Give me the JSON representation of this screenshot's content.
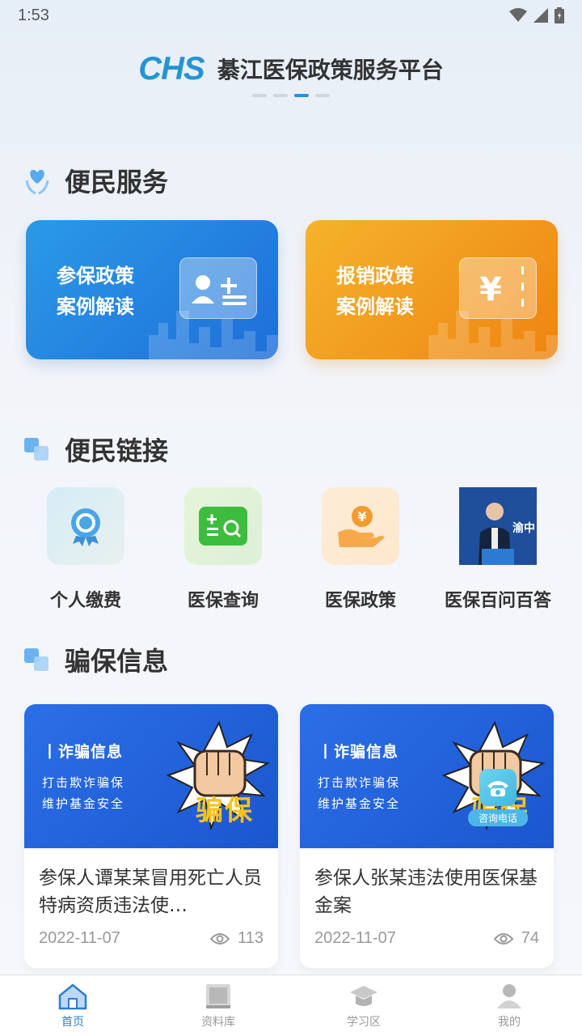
{
  "status": {
    "time": "1:53"
  },
  "banner": {
    "logo": "CHS",
    "title": "綦江医保政策服务平台"
  },
  "sections": {
    "services": "便民服务",
    "links": "便民链接",
    "fraud": "骗保信息"
  },
  "service_cards": [
    {
      "line1": "参保政策",
      "line2": "案例解读",
      "color": "#2a9ae8"
    },
    {
      "line1": "报销政策",
      "line2": "案例解读",
      "color": "#f5b32b"
    }
  ],
  "links": [
    {
      "label": "个人缴费",
      "icon": "badge-icon"
    },
    {
      "label": "医保查询",
      "icon": "search-card-icon"
    },
    {
      "label": "医保政策",
      "icon": "hand-yuan-icon"
    },
    {
      "label": "医保百问百答",
      "icon": "video-thumbnail"
    }
  ],
  "link_thumb_text": "渝中",
  "fraud_cards": [
    {
      "head": "丨诈骗信息",
      "sub1": "打击欺诈骗保",
      "sub2": "维护基金安全",
      "stamp": "骗保",
      "title": "参保人谭某某冒用死亡人员特病资质违法使…",
      "date": "2022-11-07",
      "views": "113"
    },
    {
      "head": "丨诈骗信息",
      "sub1": "打击欺诈骗保",
      "sub2": "维护基金安全",
      "stamp": "骗保",
      "title": "参保人张某违法使用医保基金案",
      "date": "2022-11-07",
      "views": "74"
    }
  ],
  "consult_label": "咨询电话",
  "tabs": [
    {
      "label": "首页",
      "active": true
    },
    {
      "label": "资料库",
      "active": false
    },
    {
      "label": "学习区",
      "active": false
    },
    {
      "label": "我的",
      "active": false
    }
  ],
  "colors": {
    "accent": "#2b7fd4",
    "blue_card": "#2a9ae8",
    "orange_card": "#f5b32b"
  }
}
